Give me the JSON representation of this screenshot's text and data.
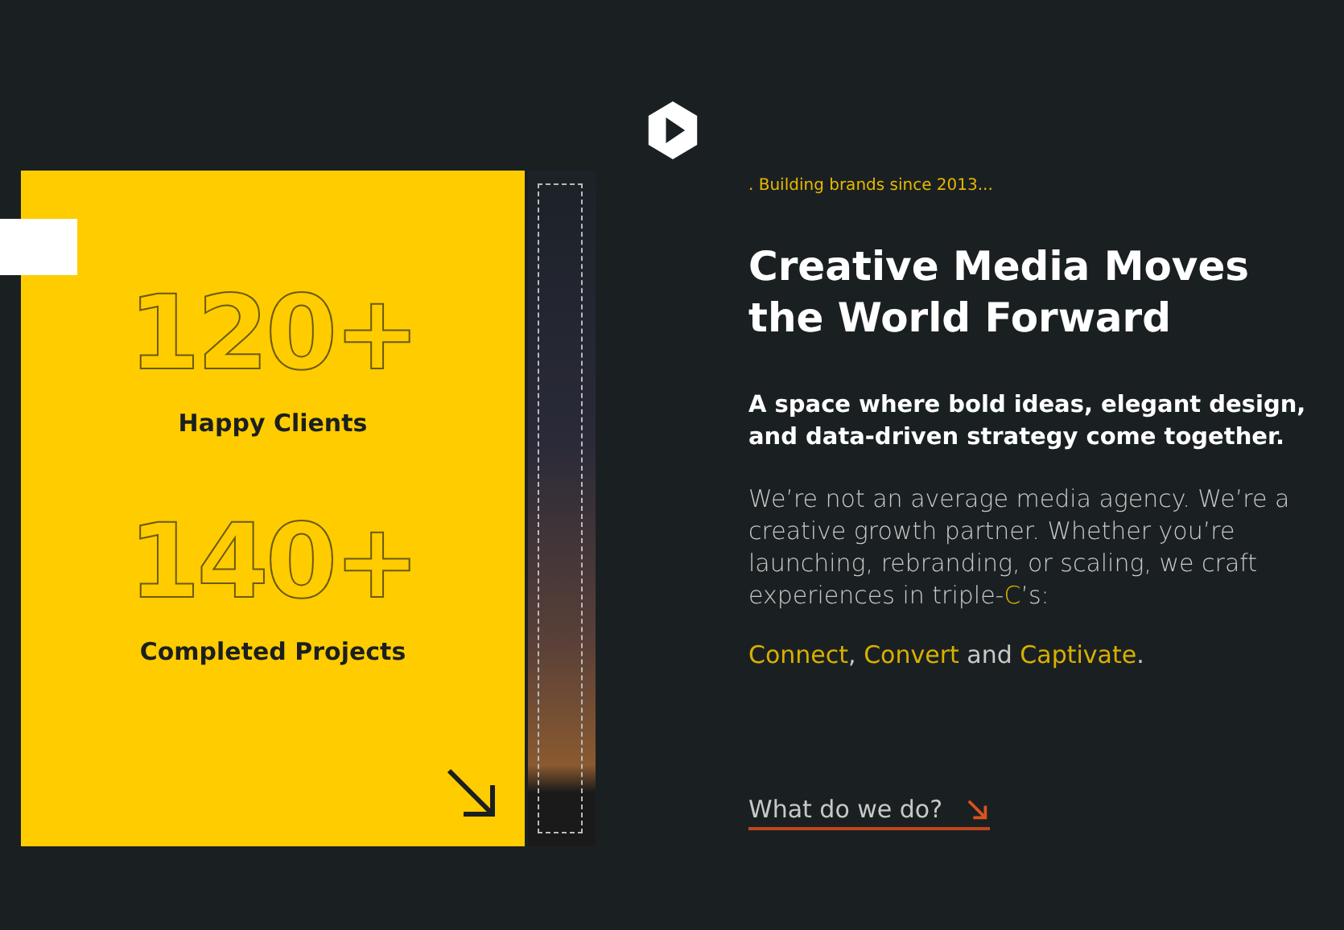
{
  "stats": [
    {
      "number": "120+",
      "label": "Happy Clients"
    },
    {
      "number": "140+",
      "label": "Completed Projects"
    }
  ],
  "tagline": ". Building brands since 2013...",
  "headline": "Creative Media Moves the World Forward",
  "subheadline": "A space where bold ideas, elegant design, and data-driven strategy come together.",
  "intro": [
    {
      "text": "We’re not an average media agency. We’re a creative growth partner. Whether you’re launching, rebranding, or scaling, we craft experiences in triple-",
      "highlight": false
    },
    {
      "text": "C",
      "highlight": true
    },
    {
      "text": "’s:",
      "highlight": false
    }
  ],
  "pillars": [
    {
      "text": "Connect",
      "highlight": true
    },
    {
      "text": ", ",
      "highlight": false
    },
    {
      "text": "Convert",
      "highlight": true
    },
    {
      "text": " and ",
      "highlight": false
    },
    {
      "text": "Captivate",
      "highlight": true
    },
    {
      "text": ".",
      "highlight": false
    }
  ],
  "cta": "What do we do?"
}
